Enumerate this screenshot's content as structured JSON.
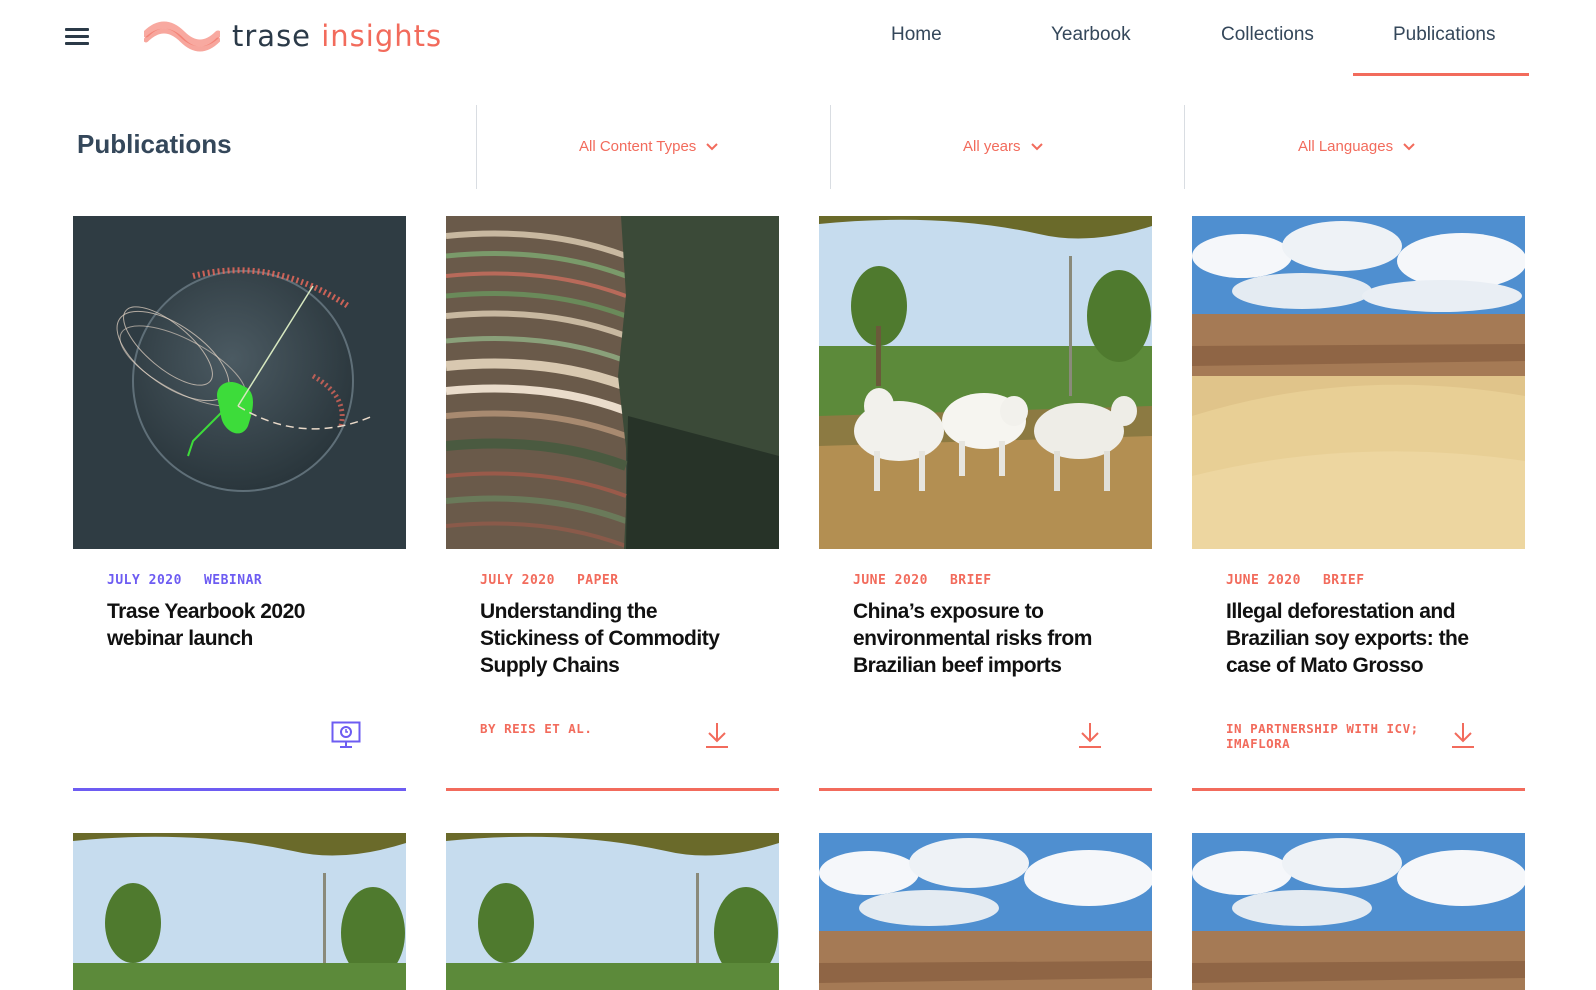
{
  "header": {
    "logo_part1": "trase",
    "logo_part2": "insights",
    "nav": [
      {
        "label": "Home"
      },
      {
        "label": "Yearbook"
      },
      {
        "label": "Collections"
      },
      {
        "label": "Publications",
        "active": true
      }
    ]
  },
  "filters": {
    "page_title": "Publications",
    "content_types": "All Content Types",
    "years": "All years",
    "languages": "All Languages"
  },
  "cards": [
    {
      "date": "JULY 2020",
      "type": "WEBINAR",
      "title": "Trase Yearbook 2020 webinar launch",
      "footer": "",
      "action_icon": "webinar-screen-icon",
      "accent": "#6d5cf2",
      "image": "globe-visualization"
    },
    {
      "date": "JULY 2020",
      "type": "PAPER",
      "title": "Understanding the Stickiness of Commodity Supply Chains",
      "footer": "BY REIS ET AL.",
      "action_icon": "download-icon",
      "accent": "#f26b5c",
      "image": "aerial-fields"
    },
    {
      "date": "JUNE 2020",
      "type": "BRIEF",
      "title": "China’s exposure to environmental risks from Brazilian beef imports",
      "footer": "",
      "action_icon": "download-icon",
      "accent": "#f26b5c",
      "image": "white-cattle"
    },
    {
      "date": "JUNE 2020",
      "type": "BRIEF",
      "title": "Illegal deforestation and Brazilian soy exports: the case of Mato Grosso",
      "footer": "IN PARTNERSHIP WITH ICV; IMAFLORA",
      "action_icon": "download-icon",
      "accent": "#f26b5c",
      "image": "soybean-field"
    }
  ],
  "colors": {
    "accent": "#f26b5c",
    "webinar": "#6d5cf2",
    "text": "#2b3a48"
  }
}
